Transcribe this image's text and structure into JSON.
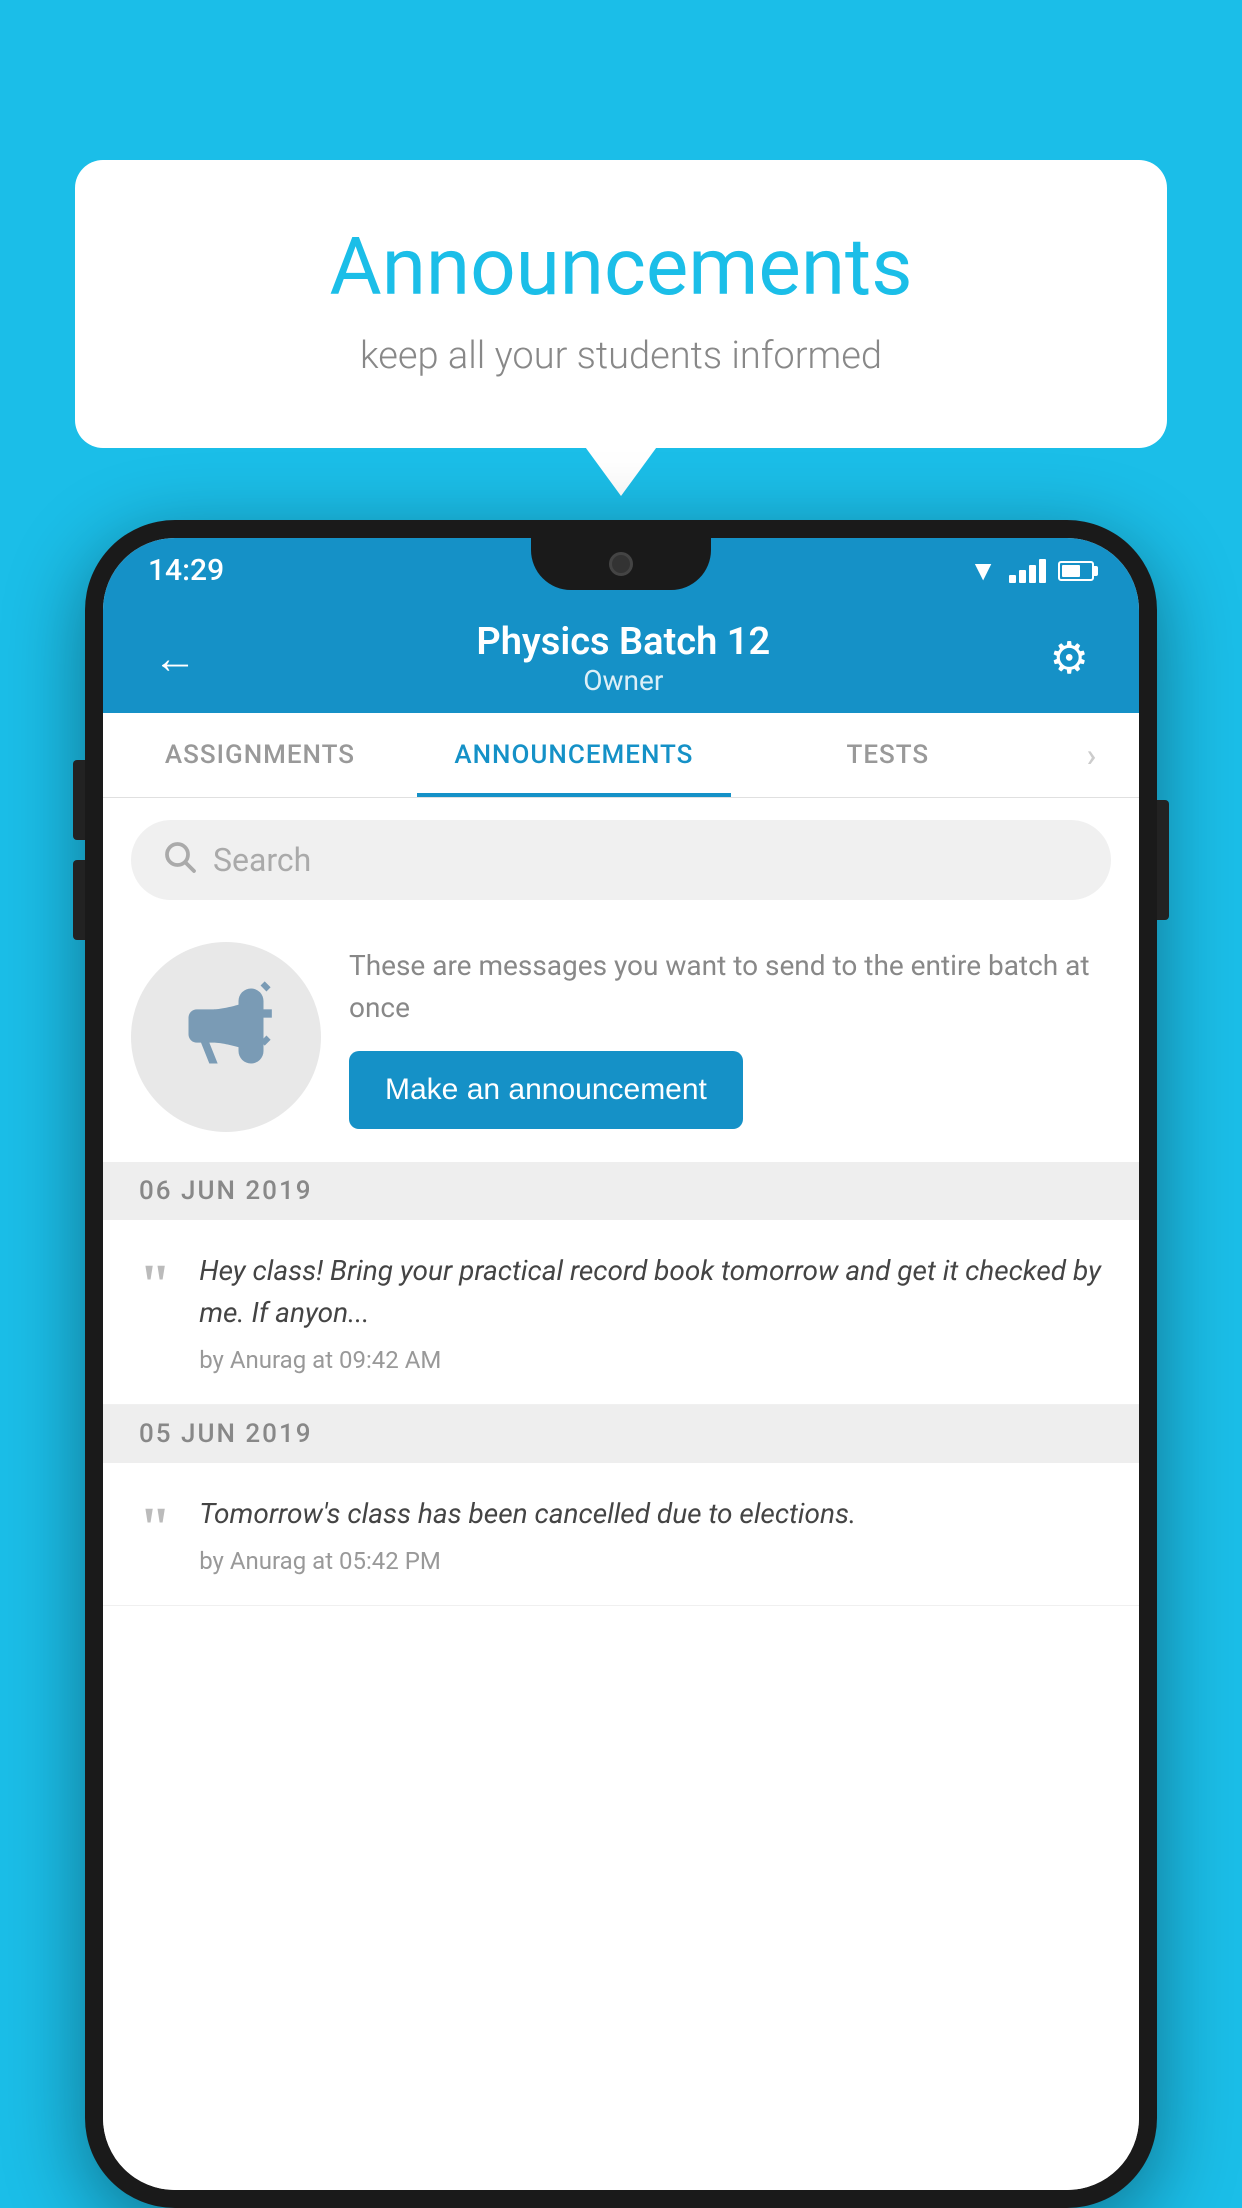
{
  "bubble": {
    "title": "Announcements",
    "subtitle": "keep all your students informed"
  },
  "status_bar": {
    "time": "14:29"
  },
  "header": {
    "title": "Physics Batch 12",
    "subtitle": "Owner",
    "back_label": "←",
    "gear_label": "⚙"
  },
  "tabs": [
    {
      "label": "ASSIGNMENTS",
      "active": false
    },
    {
      "label": "ANNOUNCEMENTS",
      "active": true
    },
    {
      "label": "TESTS",
      "active": false
    },
    {
      "label": "·",
      "active": false
    }
  ],
  "search": {
    "placeholder": "Search"
  },
  "announcement_cta": {
    "description": "These are messages you want to send to the entire batch at once",
    "button_label": "Make an announcement"
  },
  "messages": [
    {
      "date": "06  JUN  2019",
      "text": "Hey class! Bring your practical record book tomorrow and get it checked by me. If anyon...",
      "by": "by Anurag at 09:42 AM"
    },
    {
      "date": "05  JUN  2019",
      "text": "Tomorrow's class has been cancelled due to elections.",
      "by": "by Anurag at 05:42 PM"
    }
  ]
}
